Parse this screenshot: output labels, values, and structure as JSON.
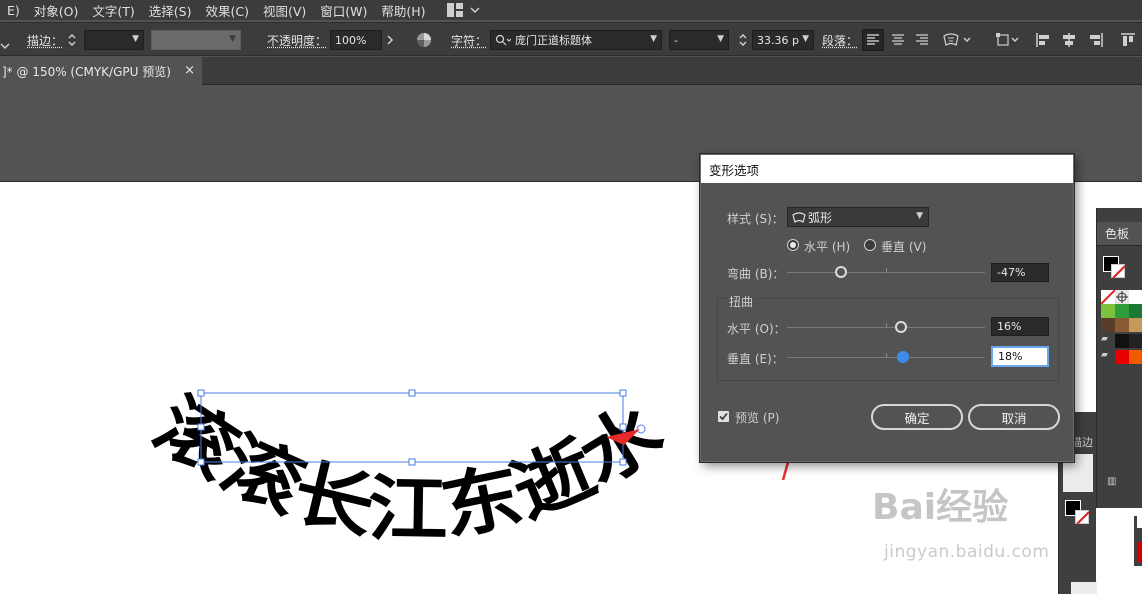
{
  "menu": {
    "items": [
      "E)",
      "对象(O)",
      "文字(T)",
      "选择(S)",
      "效果(C)",
      "视图(V)",
      "窗口(W)",
      "帮助(H)"
    ]
  },
  "control_bar": {
    "stroke_label": "描边：",
    "opacity_label": "不透明度：",
    "opacity_value": "100%",
    "char_label": "字符：",
    "font_name": "庞门正道标题体",
    "font_style": "-",
    "font_size": "33.36 p",
    "para_label": "段落："
  },
  "tab": {
    "title": "]* @ 150% (CMYK/GPU 预览)",
    "close": "×"
  },
  "artwork": {
    "text": "滚滚长江东逝水"
  },
  "dialog": {
    "title": "变形选项",
    "style_label": "样式 (S)：",
    "style_value": "弧形",
    "horizontal_label": "水平 (H)",
    "vertical_label": "垂直 (V)",
    "bend_label": "弯曲 (B)：",
    "bend_value": "-47%",
    "distortion_label": "扭曲",
    "dist_h_label": "水平 (O)：",
    "dist_h_value": "16%",
    "dist_v_label": "垂直 (E)：",
    "dist_v_value": "18%",
    "preview_label": "预览 (P)",
    "ok_label": "确定",
    "cancel_label": "取消"
  },
  "panels": {
    "swatches_tab": "色板",
    "side_label": "描边"
  },
  "watermark": {
    "brand": "Bai经验",
    "url": "jingyan.baidu.com"
  }
}
